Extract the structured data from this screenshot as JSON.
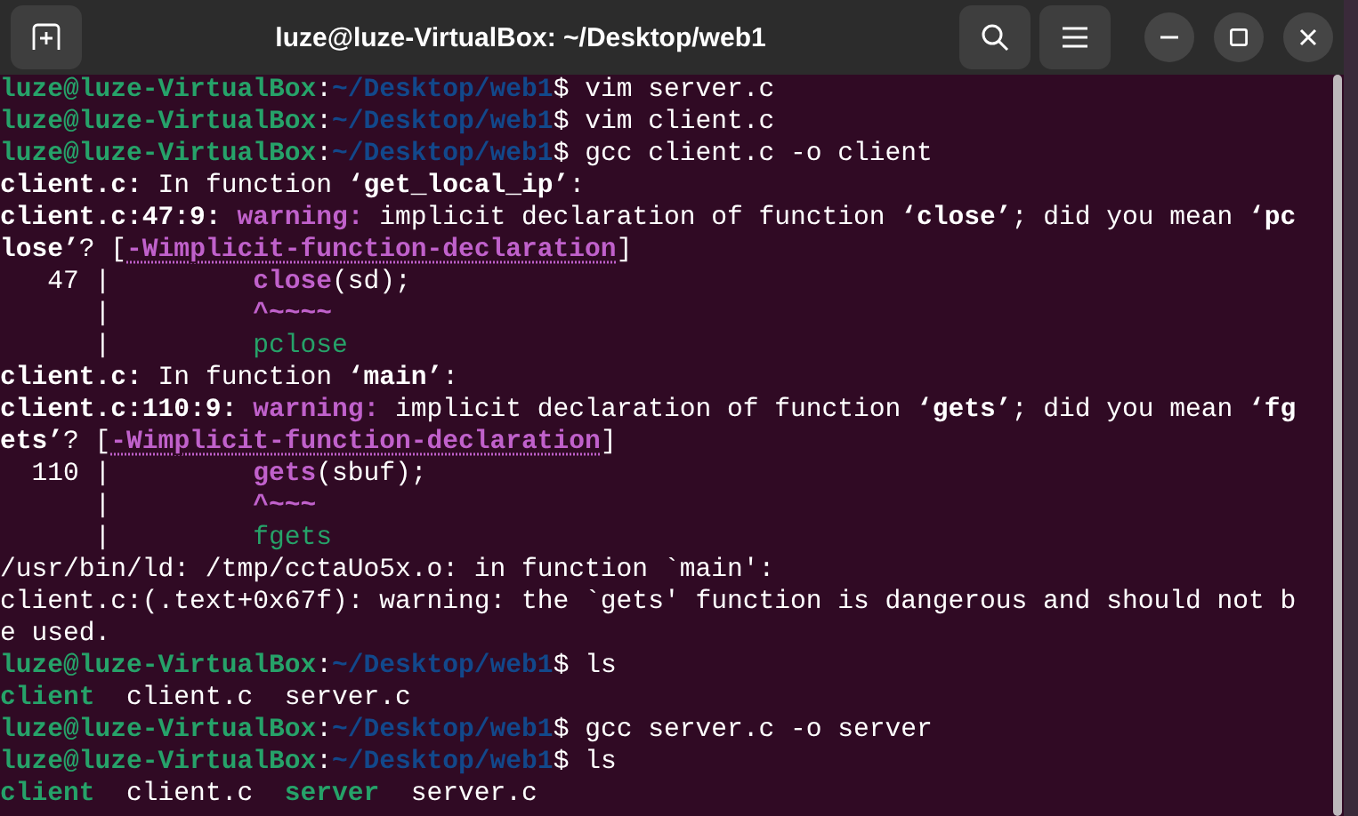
{
  "window": {
    "title": "luze@luze-VirtualBox: ~/Desktop/web1"
  },
  "terminal": {
    "lines": [
      {
        "segments": [
          {
            "text": "luze@luze-VirtualBox",
            "kind": "user"
          },
          {
            "text": ":",
            "kind": "plain"
          },
          {
            "text": "~/Desktop/web1",
            "kind": "path"
          },
          {
            "text": "$ vim server.c",
            "kind": "plain"
          }
        ]
      },
      {
        "segments": [
          {
            "text": "luze@luze-VirtualBox",
            "kind": "user"
          },
          {
            "text": ":",
            "kind": "plain"
          },
          {
            "text": "~/Desktop/web1",
            "kind": "path"
          },
          {
            "text": "$ vim client.c",
            "kind": "plain"
          }
        ]
      },
      {
        "segments": [
          {
            "text": "luze@luze-VirtualBox",
            "kind": "user"
          },
          {
            "text": ":",
            "kind": "plain"
          },
          {
            "text": "~/Desktop/web1",
            "kind": "path"
          },
          {
            "text": "$ gcc client.c -o client",
            "kind": "plain"
          }
        ]
      },
      {
        "segments": [
          {
            "text": "client.c:",
            "kind": "bold"
          },
          {
            "text": " In function ",
            "kind": "plain"
          },
          {
            "text": "‘get_local_ip’",
            "kind": "bold"
          },
          {
            "text": ":",
            "kind": "plain"
          }
        ]
      },
      {
        "segments": [
          {
            "text": "client.c:47:9: ",
            "kind": "bold"
          },
          {
            "text": "warning:",
            "kind": "warning"
          },
          {
            "text": " implicit declaration of function ",
            "kind": "plain"
          },
          {
            "text": "‘close’",
            "kind": "bold"
          },
          {
            "text": "; did you mean ",
            "kind": "plain"
          },
          {
            "text": "‘pc",
            "kind": "bold"
          }
        ]
      },
      {
        "segments": [
          {
            "text": "lose’",
            "kind": "bold"
          },
          {
            "text": "? [",
            "kind": "plain"
          },
          {
            "text": "-Wimplicit-function-declaration",
            "kind": "option"
          },
          {
            "text": "]",
            "kind": "plain"
          }
        ]
      },
      {
        "segments": [
          {
            "text": "   47 |         ",
            "kind": "plain"
          },
          {
            "text": "close",
            "kind": "highlight"
          },
          {
            "text": "(sd);",
            "kind": "plain"
          }
        ]
      },
      {
        "segments": [
          {
            "text": "      |         ",
            "kind": "plain"
          },
          {
            "text": "^~~~~",
            "kind": "highlight"
          }
        ]
      },
      {
        "segments": [
          {
            "text": "      |         ",
            "kind": "plain"
          },
          {
            "text": "pclose",
            "kind": "fixit"
          }
        ]
      },
      {
        "segments": [
          {
            "text": "client.c:",
            "kind": "bold"
          },
          {
            "text": " In function ",
            "kind": "plain"
          },
          {
            "text": "‘main’",
            "kind": "bold"
          },
          {
            "text": ":",
            "kind": "plain"
          }
        ]
      },
      {
        "segments": [
          {
            "text": "client.c:110:9: ",
            "kind": "bold"
          },
          {
            "text": "warning:",
            "kind": "warning"
          },
          {
            "text": " implicit declaration of function ",
            "kind": "plain"
          },
          {
            "text": "‘gets’",
            "kind": "bold"
          },
          {
            "text": "; did you mean ",
            "kind": "plain"
          },
          {
            "text": "‘fg",
            "kind": "bold"
          }
        ]
      },
      {
        "segments": [
          {
            "text": "ets’",
            "kind": "bold"
          },
          {
            "text": "? [",
            "kind": "plain"
          },
          {
            "text": "-Wimplicit-function-declaration",
            "kind": "option"
          },
          {
            "text": "]",
            "kind": "plain"
          }
        ]
      },
      {
        "segments": [
          {
            "text": "  110 |         ",
            "kind": "plain"
          },
          {
            "text": "gets",
            "kind": "highlight"
          },
          {
            "text": "(sbuf);",
            "kind": "plain"
          }
        ]
      },
      {
        "segments": [
          {
            "text": "      |         ",
            "kind": "plain"
          },
          {
            "text": "^~~~",
            "kind": "highlight"
          }
        ]
      },
      {
        "segments": [
          {
            "text": "      |         ",
            "kind": "plain"
          },
          {
            "text": "fgets",
            "kind": "fixit"
          }
        ]
      },
      {
        "segments": [
          {
            "text": "/usr/bin/ld: /tmp/cctaUo5x.o: in function `main':",
            "kind": "plain"
          }
        ]
      },
      {
        "segments": [
          {
            "text": "client.c:(.text+0x67f): warning: the `gets' function is dangerous and should not b",
            "kind": "plain"
          }
        ]
      },
      {
        "segments": [
          {
            "text": "e used.",
            "kind": "plain"
          }
        ]
      },
      {
        "segments": [
          {
            "text": "luze@luze-VirtualBox",
            "kind": "user"
          },
          {
            "text": ":",
            "kind": "plain"
          },
          {
            "text": "~/Desktop/web1",
            "kind": "path"
          },
          {
            "text": "$ ls",
            "kind": "plain"
          }
        ]
      },
      {
        "segments": [
          {
            "text": "client",
            "kind": "exec"
          },
          {
            "text": "  client.c  server.c",
            "kind": "plain"
          }
        ]
      },
      {
        "segments": [
          {
            "text": "luze@luze-VirtualBox",
            "kind": "user"
          },
          {
            "text": ":",
            "kind": "plain"
          },
          {
            "text": "~/Desktop/web1",
            "kind": "path"
          },
          {
            "text": "$ gcc server.c -o server",
            "kind": "plain"
          }
        ]
      },
      {
        "segments": [
          {
            "text": "luze@luze-VirtualBox",
            "kind": "user"
          },
          {
            "text": ":",
            "kind": "plain"
          },
          {
            "text": "~/Desktop/web1",
            "kind": "path"
          },
          {
            "text": "$ ls",
            "kind": "plain"
          }
        ]
      },
      {
        "segments": [
          {
            "text": "client",
            "kind": "exec"
          },
          {
            "text": "  client.c  ",
            "kind": "plain"
          },
          {
            "text": "server",
            "kind": "exec"
          },
          {
            "text": "  server.c",
            "kind": "plain"
          }
        ]
      }
    ]
  }
}
